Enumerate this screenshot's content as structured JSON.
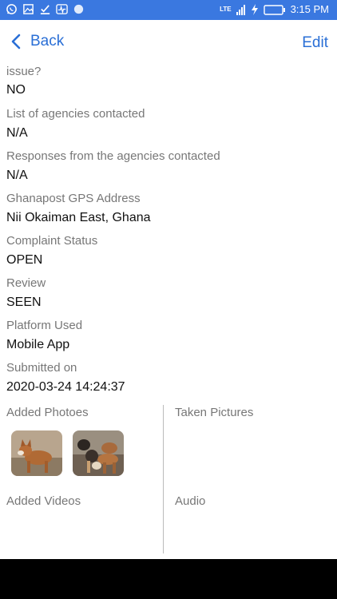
{
  "status_bar": {
    "time": "3:15 PM",
    "network": "LTE",
    "icons": [
      "whatsapp-icon",
      "image-icon",
      "check-download-icon",
      "activity-icon",
      "dot-icon"
    ]
  },
  "nav": {
    "back_label": "Back",
    "edit_label": "Edit",
    "accent_color": "#2a6fd6"
  },
  "fields": [
    {
      "label": "issue?",
      "value": "NO"
    },
    {
      "label": "List of agencies contacted",
      "value": "N/A"
    },
    {
      "label": "Responses from the agencies contacted",
      "value": "N/A"
    },
    {
      "label": "Ghanapost GPS Address",
      "value": "Nii Okaiman East, Ghana"
    },
    {
      "label": "Complaint Status",
      "value": "OPEN"
    },
    {
      "label": "Review",
      "value": "SEEN"
    },
    {
      "label": "Platform Used",
      "value": "Mobile App"
    },
    {
      "label": "Submitted on",
      "value": "2020-03-24 14:24:37"
    }
  ],
  "media": {
    "added_photos_label": "Added Photoes",
    "taken_pictures_label": "Taken Pictures",
    "added_videos_label": "Added Videos",
    "audio_label": "Audio",
    "photos": [
      "dog-photo",
      "dogs-group-photo"
    ]
  }
}
